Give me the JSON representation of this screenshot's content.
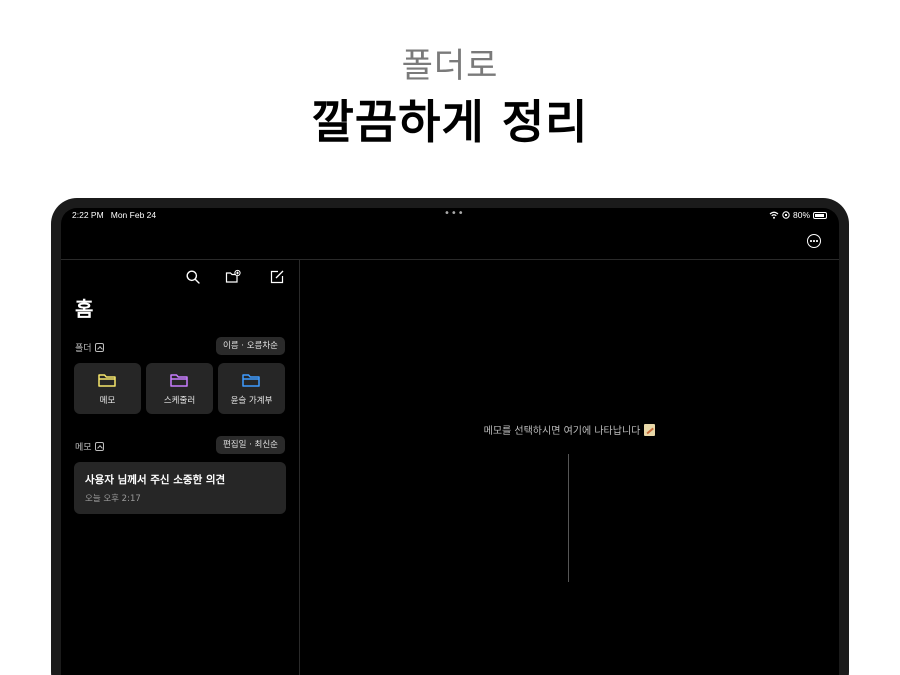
{
  "headline": {
    "sub": "폴더로",
    "main": "깔끔하게 정리"
  },
  "statusbar": {
    "time": "2:22 PM",
    "date": "Mon Feb 24",
    "battery": "80%"
  },
  "icons": {
    "more": "ellipsis-circle-icon",
    "search": "search-icon",
    "new_folder": "folder-add-icon",
    "compose": "compose-icon"
  },
  "sidebar": {
    "title": "홈",
    "folder_section": {
      "label": "폴더",
      "sort": "이름 · 오름차순"
    },
    "folders": [
      {
        "name": "메모",
        "color": "#f5e56b"
      },
      {
        "name": "스케줄러",
        "color": "#c77dff"
      },
      {
        "name": "윤슬 가계부",
        "color": "#3f9bff"
      }
    ],
    "memo_section": {
      "label": "메모",
      "sort": "편집일 · 최신순"
    },
    "memos": [
      {
        "title": "사용자 님께서 주신 소중한 의견",
        "time": "오늘 오후 2:17"
      }
    ]
  },
  "detail": {
    "placeholder": "메모를 선택하시면 여기에 나타납니다"
  }
}
